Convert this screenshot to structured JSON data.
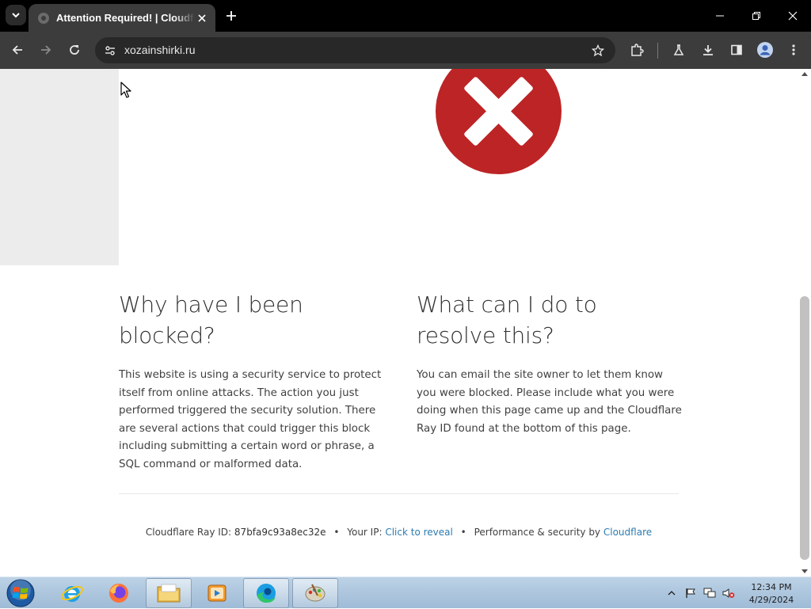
{
  "browser": {
    "tab": {
      "title": "Attention Required! | Cloudflare"
    },
    "address_bar": {
      "url": "xozainshirki.ru"
    }
  },
  "page": {
    "why": {
      "heading": "Why have I been blocked?",
      "body": "This website is using a security service to protect itself from online attacks. The action you just performed triggered the security solution. There are several actions that could trigger this block including submitting a certain word or phrase, a SQL command or malformed data."
    },
    "resolve": {
      "heading": "What can I do to resolve this?",
      "body": "You can email the site owner to let them know you were blocked. Please include what you were doing when this page came up and the Cloudflare Ray ID found at the bottom of this page."
    },
    "footer": {
      "ray_label": "Cloudflare Ray ID:",
      "ray_id": "87bfa9c93a8ec32e",
      "ip_label": "Your IP:",
      "ip_link": "Click to reveal",
      "perf_label": "Performance & security by",
      "perf_link": "Cloudflare",
      "separator": "•"
    },
    "colors": {
      "error_red": "#bd2426",
      "link_blue": "#2c7cb0"
    }
  },
  "taskbar": {
    "apps": [
      "internet-explorer",
      "firefox",
      "file-explorer",
      "media-player",
      "edge-browser",
      "paint"
    ],
    "clock": {
      "time": "12:34 PM",
      "date": "4/29/2024"
    }
  }
}
